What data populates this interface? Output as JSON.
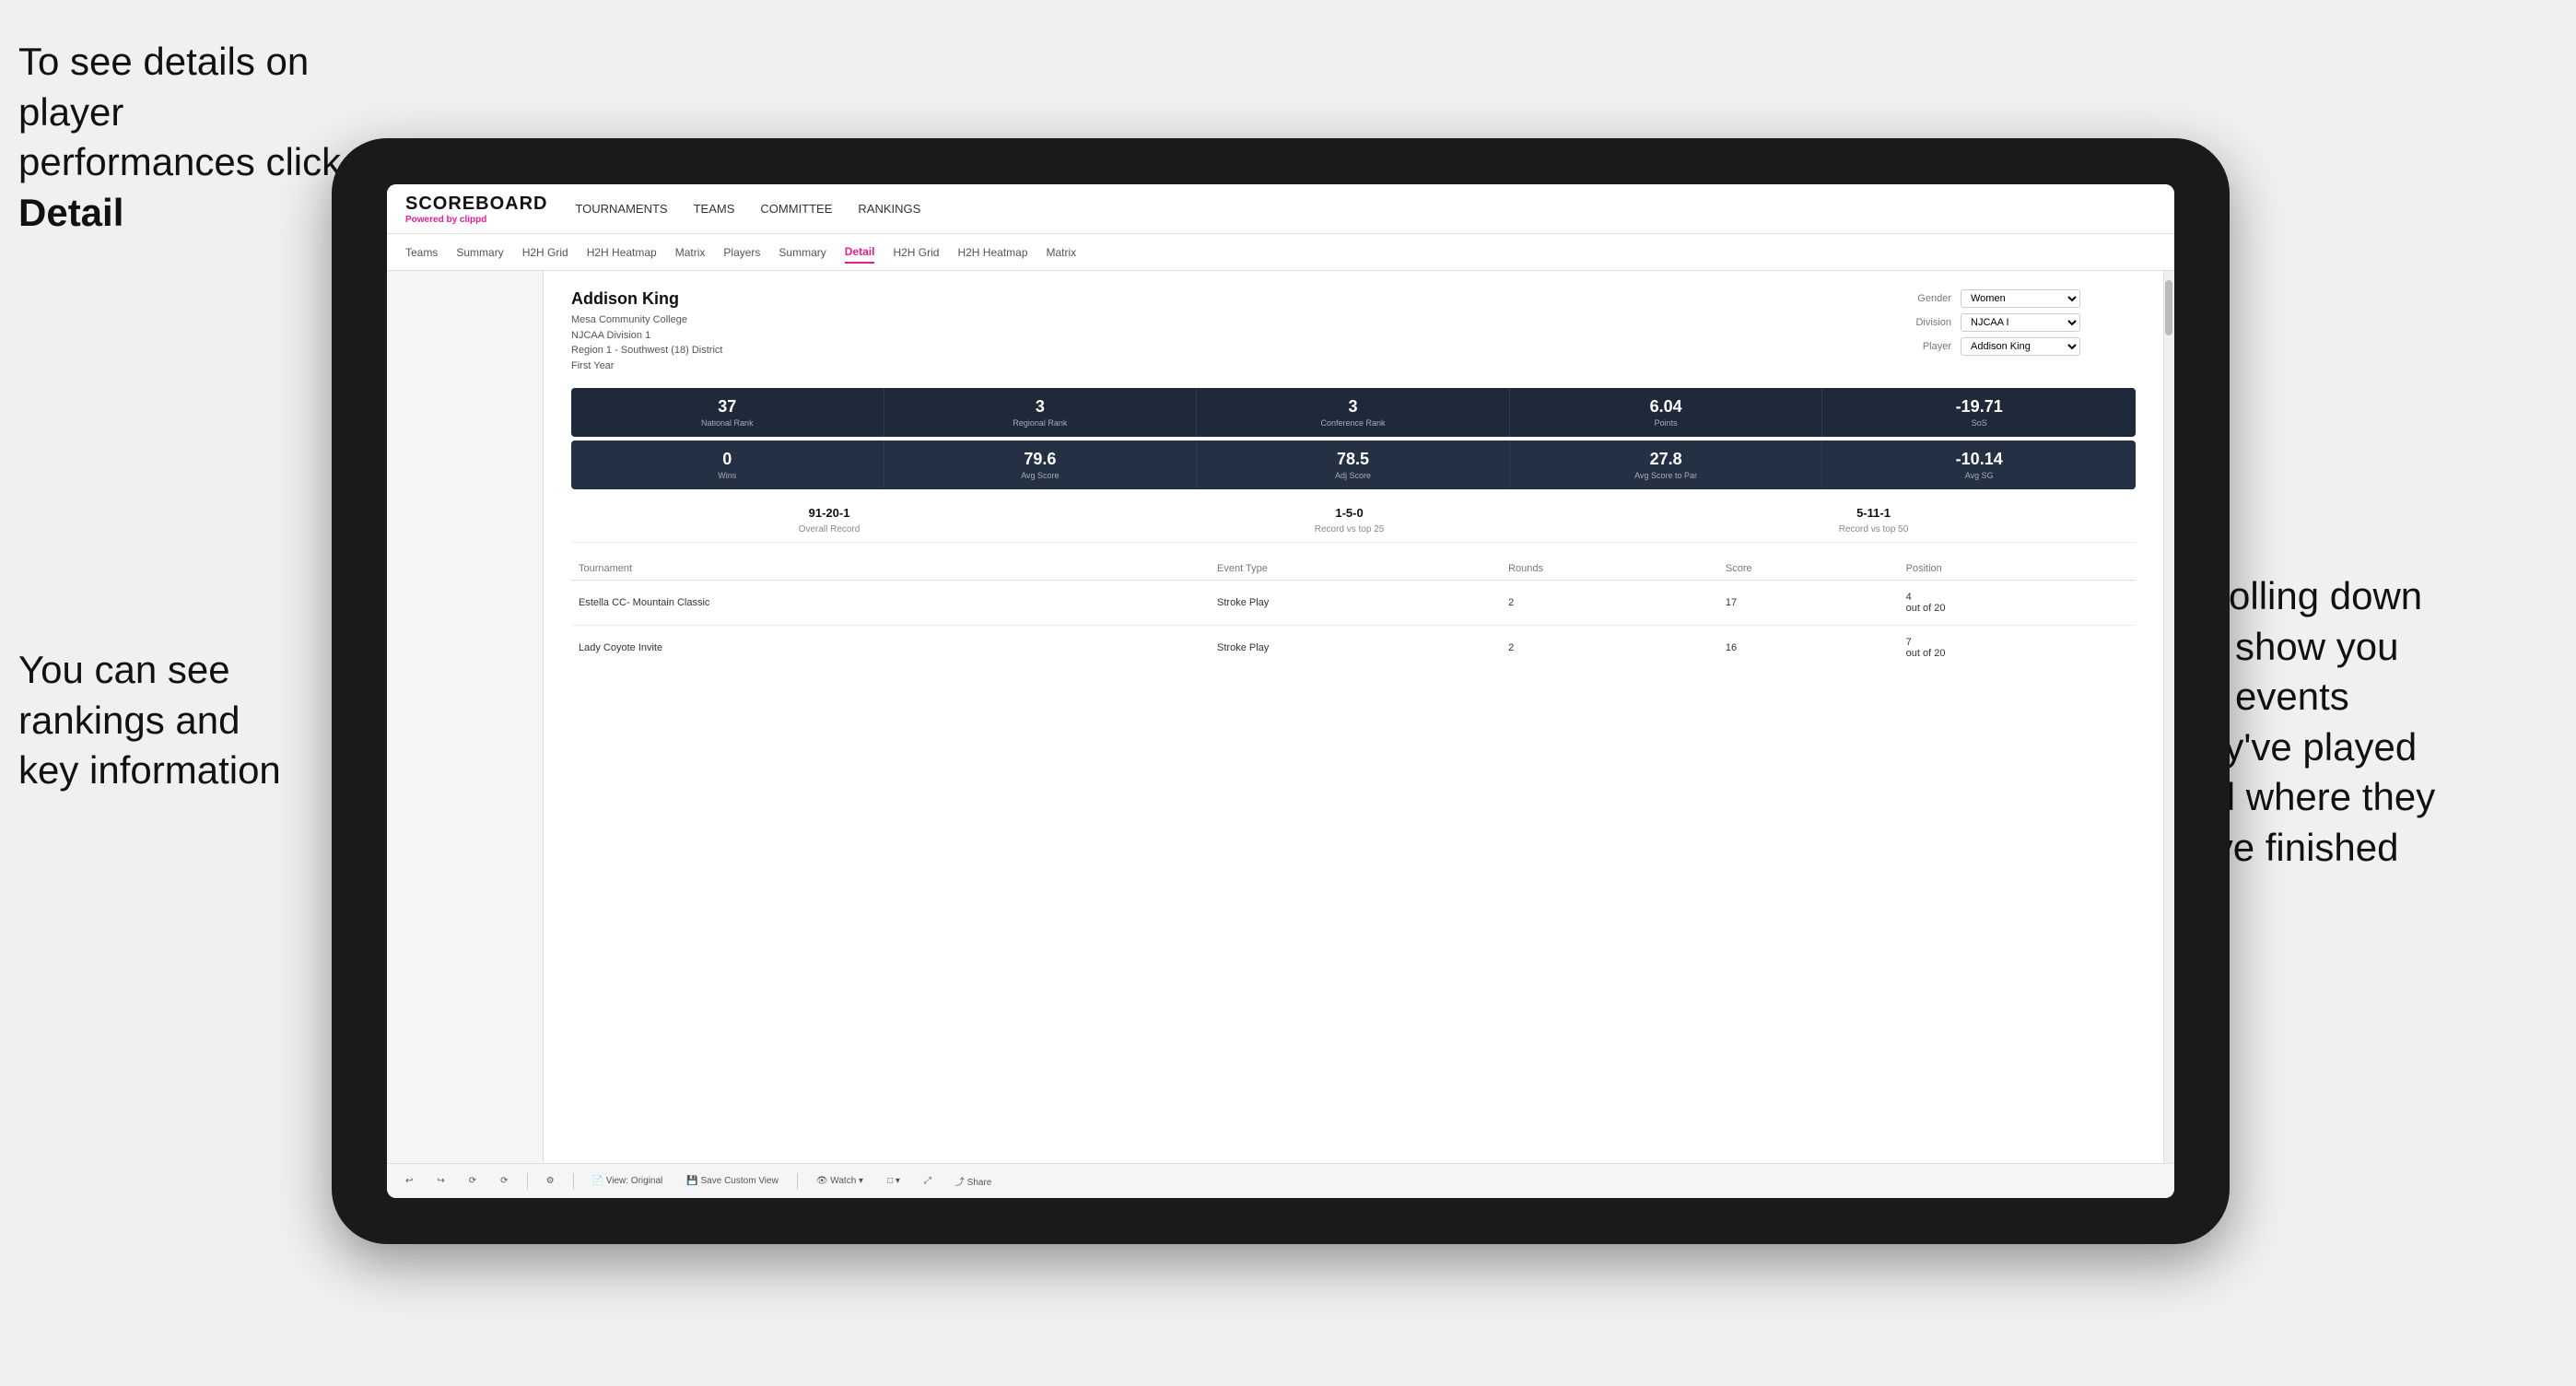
{
  "annotations": {
    "top_left": "To see details on player performances click ",
    "top_left_bold": "Detail",
    "bottom_left_line1": "You can see",
    "bottom_left_line2": "rankings and",
    "bottom_left_line3": "key information",
    "right_line1": "Scrolling down",
    "right_line2": "will show you",
    "right_line3": "the events",
    "right_line4": "they've played",
    "right_line5": "and where they",
    "right_line6": "have finished"
  },
  "nav": {
    "logo": "SCOREBOARD",
    "powered_by": "Powered by ",
    "brand": "clippd",
    "items": [
      "TOURNAMENTS",
      "TEAMS",
      "COMMITTEE",
      "RANKINGS"
    ]
  },
  "sub_nav": {
    "items": [
      "Teams",
      "Summary",
      "H2H Grid",
      "H2H Heatmap",
      "Matrix",
      "Players",
      "Summary",
      "Detail",
      "H2H Grid",
      "H2H Heatmap",
      "Matrix"
    ],
    "active_index": 7
  },
  "player": {
    "name": "Addison King",
    "school": "Mesa Community College",
    "division": "NJCAA Division 1",
    "region": "Region 1 - Southwest (18) District",
    "year": "First Year",
    "gender_label": "Gender",
    "gender_value": "Women",
    "division_label": "Division",
    "division_value": "NJCAA I",
    "player_label": "Player",
    "player_value": "Addison King"
  },
  "stats_row1": [
    {
      "value": "37",
      "label": "National Rank"
    },
    {
      "value": "3",
      "label": "Regional Rank"
    },
    {
      "value": "3",
      "label": "Conference Rank"
    },
    {
      "value": "6.04",
      "label": "Points"
    },
    {
      "value": "-19.71",
      "label": "SoS"
    }
  ],
  "stats_row2": [
    {
      "value": "0",
      "label": "Wins"
    },
    {
      "value": "79.6",
      "label": "Avg Score"
    },
    {
      "value": "78.5",
      "label": "Adj Score"
    },
    {
      "value": "27.8",
      "label": "Avg Score to Par"
    },
    {
      "value": "-10.14",
      "label": "Avg SG"
    }
  ],
  "records": [
    {
      "value": "91-20-1",
      "label": "Overall Record"
    },
    {
      "value": "1-5-0",
      "label": "Record vs top 25"
    },
    {
      "value": "5-11-1",
      "label": "Record vs top 50"
    }
  ],
  "table": {
    "headers": [
      "Tournament",
      "Event Type",
      "Rounds",
      "Score",
      "Position"
    ],
    "rows": [
      {
        "tournament": "Estella CC- Mountain Classic",
        "event_type": "Stroke Play",
        "rounds": "2",
        "score": "17",
        "position": "4\nout of 20"
      },
      {
        "tournament": "Lady Coyote Invite",
        "event_type": "Stroke Play",
        "rounds": "2",
        "score": "16",
        "position": "7\nout of 20"
      }
    ]
  },
  "toolbar": {
    "buttons": [
      "↩",
      "↪",
      "⟳",
      "⟳",
      "—",
      "⟳",
      "View: Original",
      "Save Custom View",
      "Watch ▾",
      "□ ▾",
      "⤢",
      "Share"
    ]
  }
}
